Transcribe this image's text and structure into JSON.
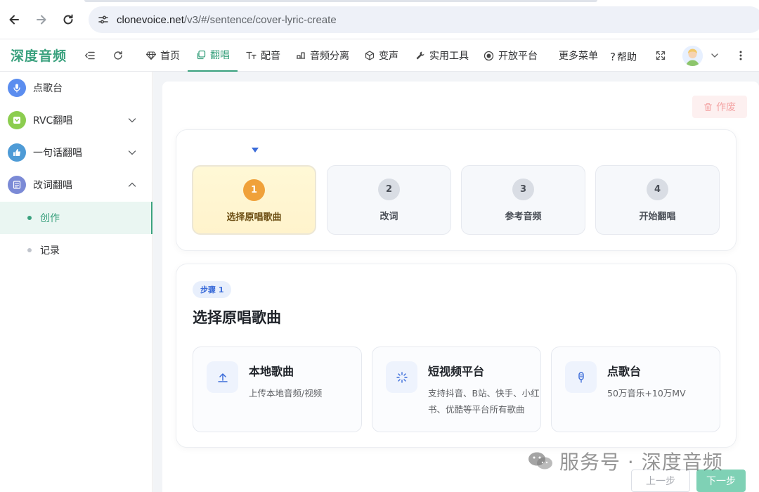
{
  "browser": {
    "url_host": "clonevoice.net",
    "url_path": "/v3/#/sentence/cover-lyric-create"
  },
  "header": {
    "brand": "深度音频",
    "menu": [
      {
        "label": "首页",
        "icon": "gem-icon"
      },
      {
        "label": "翻唱",
        "icon": "copy-icon",
        "active": true
      },
      {
        "label": "配音",
        "icon": "text-tt-icon"
      },
      {
        "label": "音频分离",
        "icon": "split-icon"
      },
      {
        "label": "变声",
        "icon": "cube-icon"
      },
      {
        "label": "实用工具",
        "icon": "wrench-icon"
      },
      {
        "label": "开放平台",
        "icon": "radio-icon"
      },
      {
        "label": "更多菜单",
        "icon": ""
      }
    ],
    "help_label": "帮助"
  },
  "sidebar": {
    "items": [
      {
        "label": "点歌台",
        "icon": "microphone-icon",
        "color": "#5b8def"
      },
      {
        "label": "RVC翻唱",
        "icon": "music-square-icon",
        "color": "#8ccd4f"
      },
      {
        "label": "一句话翻唱",
        "icon": "thumb-up-icon",
        "color": "#4e9bd6"
      },
      {
        "label": "改词翻唱",
        "icon": "edit-list-icon",
        "color": "#7b8ad6"
      }
    ],
    "subitems": [
      {
        "label": "创作",
        "active": true
      },
      {
        "label": "记录",
        "active": false
      }
    ]
  },
  "main": {
    "discard_label": "作废",
    "steps": [
      {
        "num": "1",
        "label": "选择原唱歌曲",
        "active": true
      },
      {
        "num": "2",
        "label": "改词",
        "active": false
      },
      {
        "num": "3",
        "label": "参考音频",
        "active": false
      },
      {
        "num": "4",
        "label": "开始翻唱",
        "active": false
      }
    ],
    "step_badge": "步骤 1",
    "content_title": "选择原唱歌曲",
    "options": [
      {
        "title": "本地歌曲",
        "desc": "上传本地音频/视频",
        "icon": "upload-icon"
      },
      {
        "title": "短视频平台",
        "desc": "支持抖音、B站、快手、小红书、优酷等平台所有歌曲",
        "icon": "loading-spark-icon"
      },
      {
        "title": "点歌台",
        "desc": "50万音乐+10万MV",
        "icon": "microphone-icon"
      }
    ],
    "prev_label": "上一步",
    "next_label": "下一步"
  },
  "watermark": {
    "text": "服务号 · 深度音频"
  },
  "colors": {
    "brand": "#3aa17e",
    "step_active": "#f0a13a",
    "accent_blue": "#3b6cd9"
  }
}
